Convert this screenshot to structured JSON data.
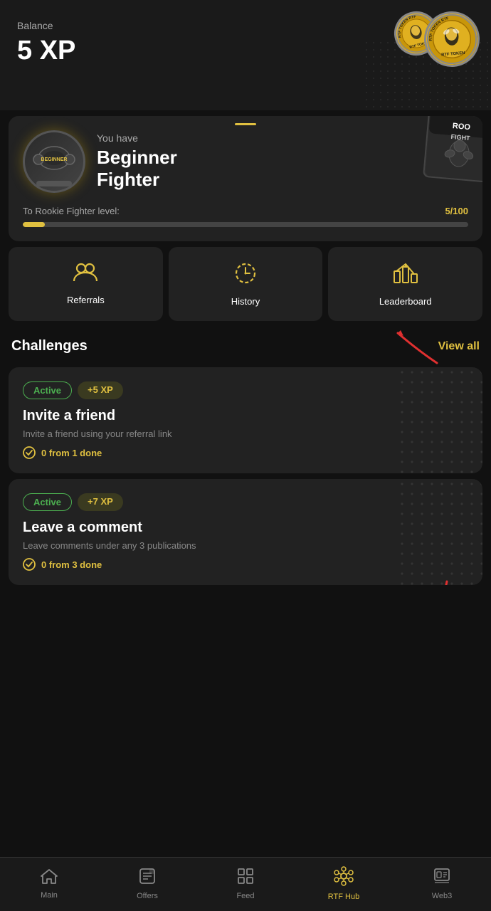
{
  "balance": {
    "label": "Balance",
    "amount": "5 XP"
  },
  "tokenCoins": {
    "small_text": "RTF TOKEN",
    "large_text": "RTF TOKEN"
  },
  "fighter": {
    "you_have": "You have",
    "title_line1": "Beginner",
    "title_line2": "Fighter",
    "progress_label": "To Rookie Fighter level:",
    "progress_current": 5,
    "progress_max": 100,
    "progress_display": "5/100",
    "progress_pct": 5
  },
  "actions": [
    {
      "id": "referrals",
      "label": "Referrals",
      "icon": "👥"
    },
    {
      "id": "history",
      "label": "History",
      "icon": "🕐"
    },
    {
      "id": "leaderboard",
      "label": "Leaderboard",
      "icon": "📊"
    }
  ],
  "challenges": {
    "title": "Challenges",
    "view_all": "View all",
    "items": [
      {
        "id": "invite",
        "status": "Active",
        "xp": "+5 XP",
        "title": "Invite a friend",
        "description": "Invite a friend using your referral link",
        "progress": "0 from 1 done"
      },
      {
        "id": "comment",
        "status": "Active",
        "xp": "+7 XP",
        "title": "Leave a comment",
        "description": "Leave comments under any 3 publications",
        "progress": "0 from 3 done"
      }
    ]
  },
  "nav": {
    "items": [
      {
        "id": "main",
        "label": "Main",
        "icon": "🏠",
        "active": false
      },
      {
        "id": "offers",
        "label": "Offers",
        "icon": "🗒",
        "active": false
      },
      {
        "id": "feed",
        "label": "Feed",
        "icon": "🔲",
        "active": false
      },
      {
        "id": "rtfhub",
        "label": "RTF Hub",
        "icon": "⬡",
        "active": true
      },
      {
        "id": "web3",
        "label": "Web3",
        "icon": "🗂",
        "active": false
      }
    ]
  }
}
